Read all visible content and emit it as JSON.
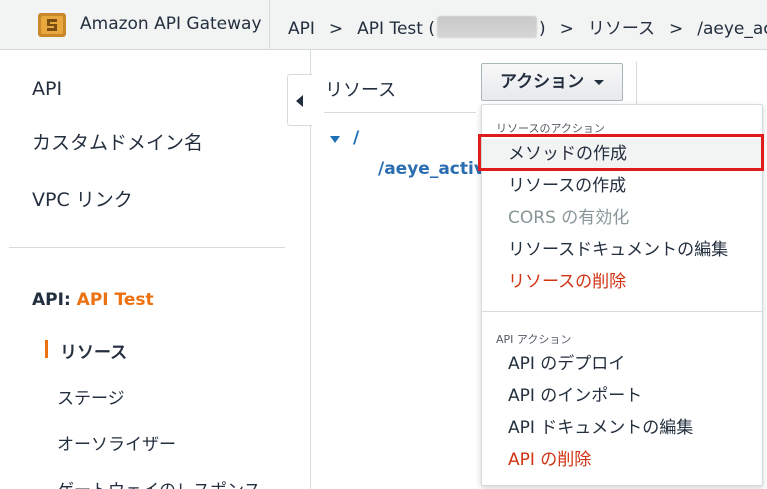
{
  "header": {
    "brand": "Amazon API Gateway",
    "breadcrumb": [
      "API",
      "API Test (",
      ")",
      "リソース",
      "/aeye_ac"
    ],
    "separator": ">"
  },
  "sidebar": {
    "top_items": [
      "API",
      "カスタムドメイン名",
      "VPC リンク"
    ],
    "api_label": "API:",
    "api_name": "API Test",
    "sub_items": [
      "リソース",
      "ステージ",
      "オーソライザー",
      "ゲートウェイのレスポンス"
    ]
  },
  "resources": {
    "title": "リソース",
    "root": "/",
    "child": "/aeye_activ"
  },
  "action_button": {
    "label": "アクション"
  },
  "dropdown": {
    "group1_label": "リソースのアクション",
    "group1_items": [
      "メソッドの作成",
      "リソースの作成",
      "CORS の有効化",
      "リソースドキュメントの編集",
      "リソースの削除"
    ],
    "group2_label": "API アクション",
    "group2_items": [
      "API のデプロイ",
      "API のインポート",
      "API ドキュメントの編集",
      "API の削除"
    ]
  },
  "colors": {
    "accent": "#ec7211",
    "link": "#1b6fb5",
    "danger": "#d13212",
    "highlight_box": "#e01b1b"
  }
}
